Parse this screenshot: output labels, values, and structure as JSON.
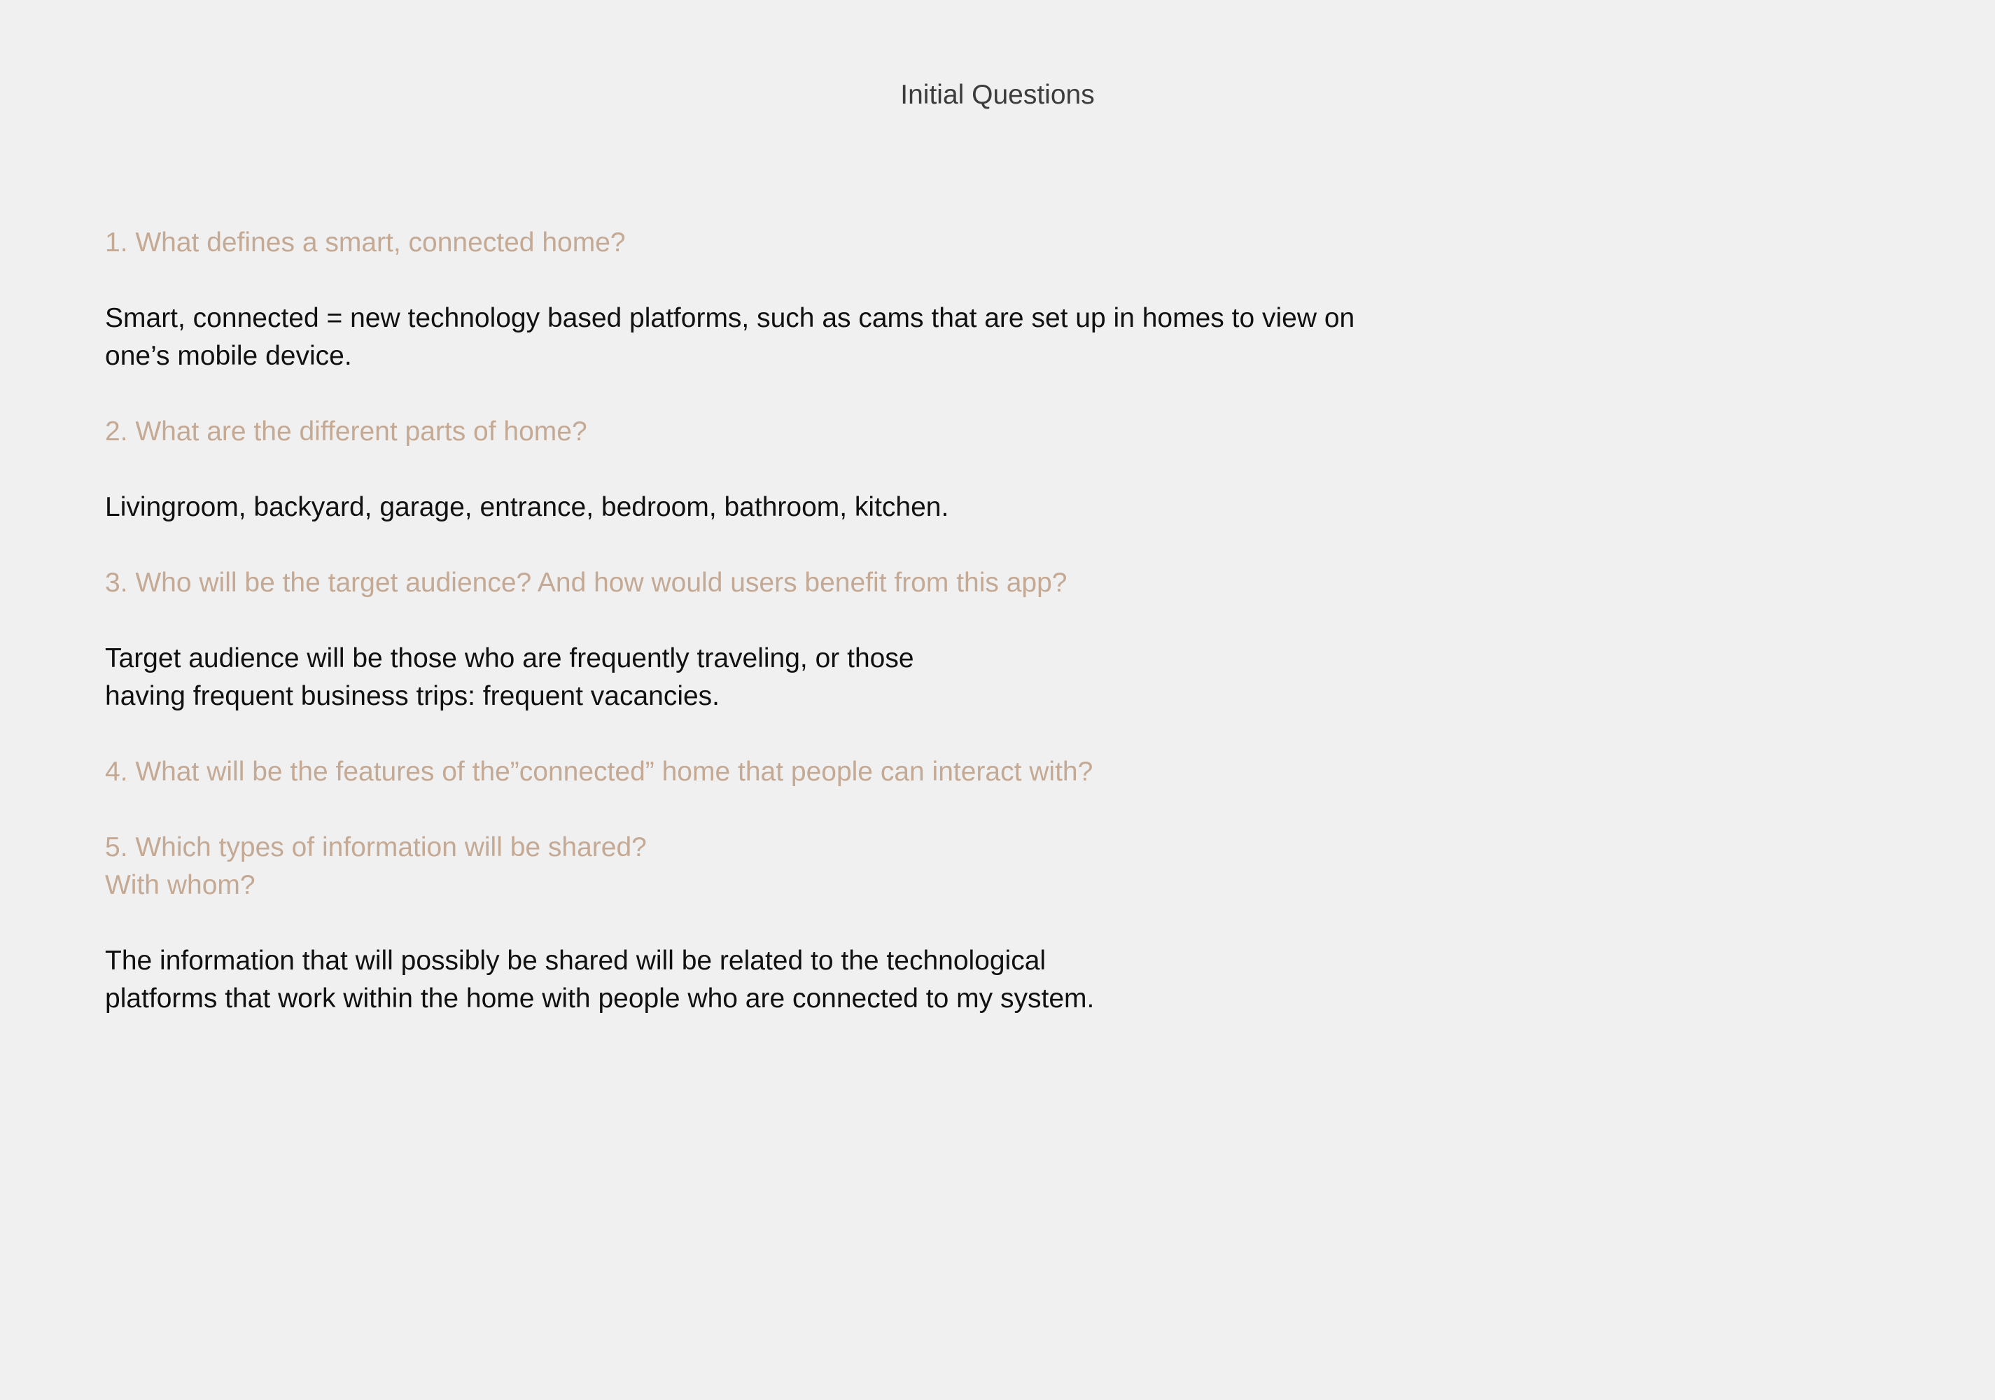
{
  "page": {
    "title": "Initial Questions"
  },
  "colors": {
    "background": "#f0f0f0",
    "question": "#c4a994",
    "answer": "#111111",
    "title": "#3c3c3c"
  },
  "items": [
    {
      "question": [
        "1. What defines a smart, connected home?"
      ],
      "answer": [
        "Smart, connected = new technology based platforms, such as cams that are set up in homes to view on",
        "one’s mobile device."
      ]
    },
    {
      "question": [
        "2. What are the different parts of home?"
      ],
      "answer": [
        "Livingroom, backyard, garage, entrance, bedroom, bathroom, kitchen."
      ]
    },
    {
      "question": [
        "3. Who will be the target audience? And how would users benefit from this app?"
      ],
      "answer": [
        "Target audience will be those who are frequently traveling, or those",
        "having frequent business trips: frequent vacancies."
      ]
    },
    {
      "question": [
        "4. What will be the features of the”connected” home that people can interact with?"
      ],
      "answer": []
    },
    {
      "question": [
        "5. Which types of information will be shared?",
        "With whom?"
      ],
      "answer": [
        "The information that will possibly be shared will be related to the technological",
        "platforms that work within the home with people who are connected to my system."
      ]
    }
  ]
}
